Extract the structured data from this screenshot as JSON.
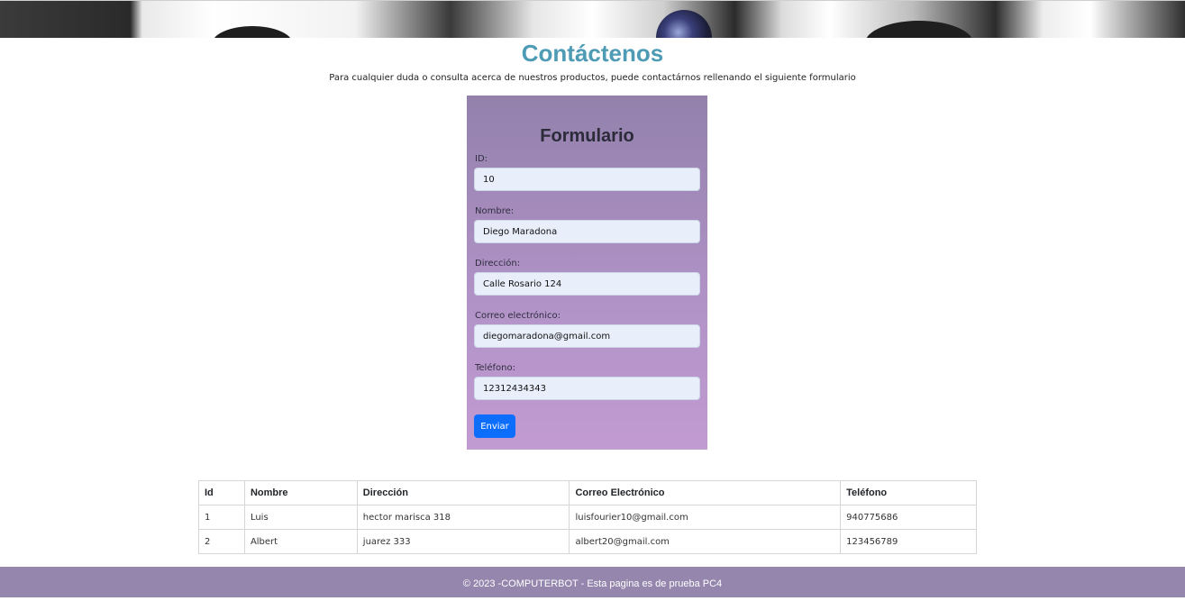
{
  "header": {
    "title": "Contáctenos",
    "subtitle": "Para cualquier duda o consulta acerca de nuestros productos, puede contactárnos rellenando el siguiente formulario"
  },
  "form": {
    "title": "Formulario",
    "fields": [
      {
        "label": "ID:",
        "value": "10"
      },
      {
        "label": "Nombre:",
        "value": "Diego Maradona"
      },
      {
        "label": "Dirección:",
        "value": "Calle Rosario 124"
      },
      {
        "label": "Correo electrónico:",
        "value": "diegomaradona@gmail.com"
      },
      {
        "label": "Teléfono:",
        "value": "12312434343"
      }
    ],
    "submit_label": "Enviar"
  },
  "table": {
    "headers": [
      "Id",
      "Nombre",
      "Dirección",
      "Correo Electrónico",
      "Teléfono"
    ],
    "rows": [
      [
        "1",
        "Luis",
        "hector marisca 318",
        "luisfourier10@gmail.com",
        "940775686"
      ],
      [
        "2",
        "Albert",
        "juarez 333",
        "albert20@gmail.com",
        "123456789"
      ]
    ]
  },
  "footer": {
    "text": "© 2023 -COMPUTERBOT - Esta pagina es de prueba PC4"
  },
  "colors": {
    "title": "#4e9bb5",
    "form_top": "#9381ac",
    "form_bottom": "#c19bd2",
    "button": "#0d6efd",
    "footer": "#9486ad"
  }
}
